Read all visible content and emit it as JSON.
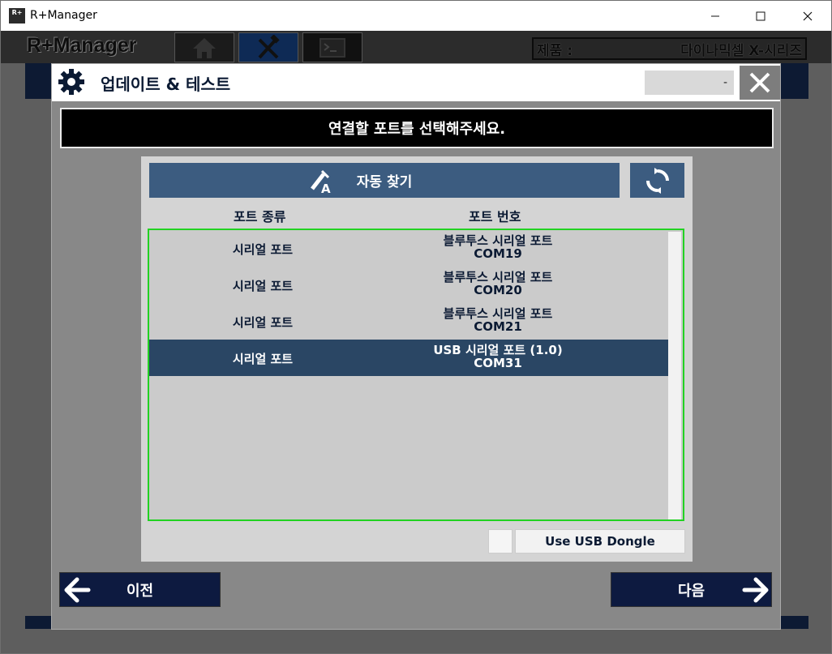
{
  "window": {
    "title": "R+Manager",
    "logo_text": "R+"
  },
  "app": {
    "logo": "R+Manager",
    "product_label": "제품 :",
    "product_value": "다이나믹셀 X-시리즈"
  },
  "dialog": {
    "title": "업데이트 & 테스트",
    "version": "-",
    "instruction": "연결할 포트를 선택해주세요.",
    "auto_search_label": "자동 찾기",
    "col_port_type": "포트 종류",
    "col_port_number": "포트 번호",
    "ports": [
      {
        "type": "시리얼 포트",
        "name": "블루투스 시리얼 포트",
        "com": "COM19",
        "selected": false
      },
      {
        "type": "시리얼 포트",
        "name": "블루투스 시리얼 포트",
        "com": "COM20",
        "selected": false
      },
      {
        "type": "시리얼 포트",
        "name": "블루투스 시리얼 포트",
        "com": "COM21",
        "selected": false
      },
      {
        "type": "시리얼 포트",
        "name": "USB 시리얼 포트 (1.0)",
        "com": "COM31",
        "selected": true
      }
    ],
    "usb_dongle_label": "Use USB Dongle",
    "usb_dongle_checked": false,
    "prev_label": "이전",
    "next_label": "다음"
  },
  "icons": {
    "app_tabs": [
      "home-icon",
      "tools-icon",
      "terminal-icon"
    ],
    "dialog": [
      "gear-icon",
      "close-icon",
      "auto-search-icon",
      "refresh-icon",
      "arrow-left-icon",
      "arrow-right-icon"
    ]
  },
  "colors": {
    "accent": "#3c5c80",
    "selected_row": "#2a4664",
    "nav_button": "#0d1a40",
    "list_border": "#22d222"
  }
}
